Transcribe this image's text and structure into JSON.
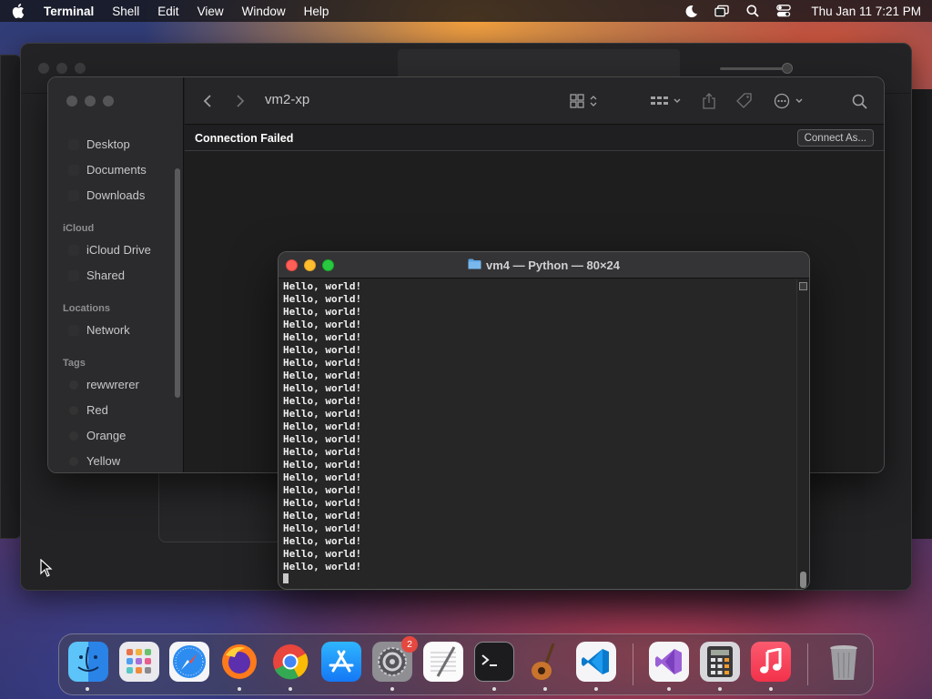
{
  "menubar": {
    "app_name": "Terminal",
    "items": [
      "Shell",
      "Edit",
      "View",
      "Window",
      "Help"
    ],
    "clock": "Thu Jan 11  7:21 PM",
    "status_icons": [
      "moon-icon",
      "screen-mirroring-icon",
      "search-icon",
      "control-center-icon"
    ]
  },
  "finder": {
    "location_title": "vm2-xp",
    "connection_message": "Connection Failed",
    "connect_button": "Connect As...",
    "favorites": [
      "Desktop",
      "Documents",
      "Downloads"
    ],
    "icloud_heading": "iCloud",
    "icloud_items": [
      "iCloud Drive",
      "Shared"
    ],
    "locations_heading": "Locations",
    "locations_items": [
      "Network"
    ],
    "tags_heading": "Tags",
    "tags": [
      "rewwrerer",
      "Red",
      "Orange",
      "Yellow"
    ]
  },
  "terminal": {
    "title": "vm4 — Python — 80×24",
    "output_lines": [
      "Hello, world!",
      "Hello, world!",
      "Hello, world!",
      "Hello, world!",
      "Hello, world!",
      "Hello, world!",
      "Hello, world!",
      "Hello, world!",
      "Hello, world!",
      "Hello, world!",
      "Hello, world!",
      "Hello, world!",
      "Hello, world!",
      "Hello, world!",
      "Hello, world!",
      "Hello, world!",
      "Hello, world!",
      "Hello, world!",
      "Hello, world!",
      "Hello, world!",
      "Hello, world!",
      "Hello, world!",
      "Hello, world!"
    ]
  },
  "dock": {
    "apps": [
      {
        "name": "finder",
        "running": true
      },
      {
        "name": "launchpad",
        "running": false
      },
      {
        "name": "safari",
        "running": false
      },
      {
        "name": "firefox",
        "running": true
      },
      {
        "name": "chrome",
        "running": true
      },
      {
        "name": "app-store",
        "running": false
      },
      {
        "name": "system-settings",
        "running": true,
        "badge": "2"
      },
      {
        "name": "textedit",
        "running": false
      },
      {
        "name": "terminal",
        "running": true
      },
      {
        "name": "garageband",
        "running": true
      },
      {
        "name": "vscode",
        "running": true
      },
      {
        "name": "visual-studio",
        "running": true
      },
      {
        "name": "calculator",
        "running": true
      },
      {
        "name": "music",
        "running": true
      },
      {
        "name": "trash",
        "running": false
      }
    ]
  },
  "colors": {
    "close": "#fe5f57",
    "minimize": "#febc2e",
    "zoom": "#28c840",
    "accent": "#0a84ff"
  }
}
